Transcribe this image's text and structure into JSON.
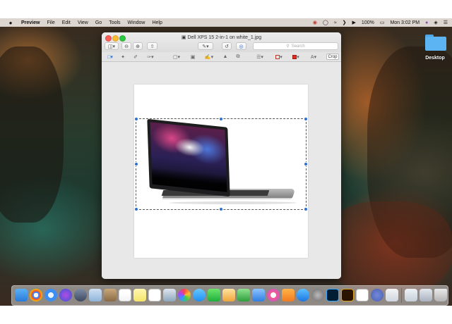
{
  "menubar": {
    "app_name": "Preview",
    "menus": [
      "File",
      "Edit",
      "View",
      "Go",
      "Tools",
      "Window",
      "Help"
    ],
    "status": {
      "battery": "100%",
      "clock": "Mon 3:02 PM"
    }
  },
  "window": {
    "title": "Dell XPS 15 2-in-1 on white_1.jpg",
    "search_placeholder": "Search",
    "crop_label": "Crop"
  },
  "desktop": {
    "folder_label": "Desktop"
  },
  "colors": {
    "selection_handle": "#2a6fd6",
    "border_color_swatch": "#c0392b",
    "fill_color_swatch": "#e02d1f"
  }
}
